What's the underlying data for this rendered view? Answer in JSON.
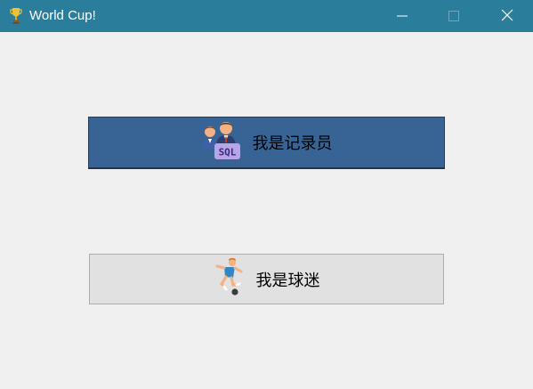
{
  "window": {
    "title": "World Cup!",
    "app_icon": "trophy-icon",
    "controls": {
      "minimize_icon": "minimize-icon",
      "maximize_icon": "maximize-icon",
      "close_icon": "close-icon"
    }
  },
  "main": {
    "recorder_button": {
      "label": "我是记录员",
      "icon": "sql-users-icon",
      "icon_badge": "SQL"
    },
    "fan_button": {
      "label": "我是球迷",
      "icon": "soccer-player-icon"
    }
  },
  "colors": {
    "titlebar": "#2b7d9c",
    "window_bg": "#f0f0f0",
    "recorder_button_bg": "#376494",
    "fan_button_bg": "#e1e1e1"
  }
}
